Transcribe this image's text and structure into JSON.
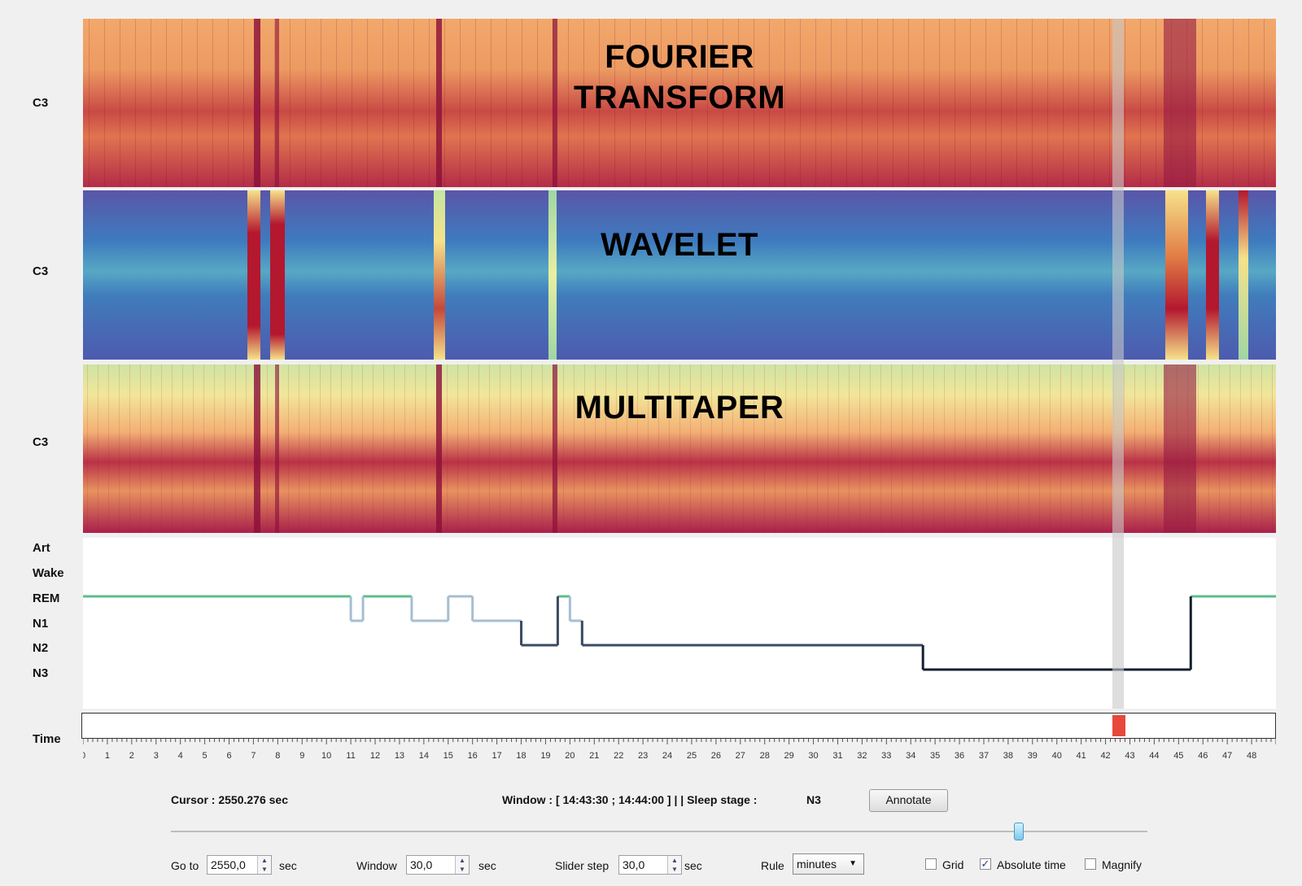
{
  "channels": {
    "fourier": {
      "label": "C3",
      "title_line1": "FOURIER",
      "title_line2": "TRANSFORM"
    },
    "wavelet": {
      "label": "C3",
      "title": "WAVELET"
    },
    "multitaper": {
      "label": "C3",
      "title": "MULTITAPER"
    }
  },
  "hypnogram": {
    "stage_labels": [
      "Art",
      "Wake",
      "REM",
      "N1",
      "N2",
      "N3"
    ],
    "x_max_minutes": 49,
    "segments": [
      {
        "start": 0,
        "end": 11.0,
        "stage": "REM",
        "color": "#5dbd8a"
      },
      {
        "start": 11.0,
        "end": 11.5,
        "stage": "N1",
        "color": "#a6bed2"
      },
      {
        "start": 11.5,
        "end": 13.5,
        "stage": "REM",
        "color": "#5dbd8a"
      },
      {
        "start": 13.5,
        "end": 15.0,
        "stage": "N1",
        "color": "#a6bed2"
      },
      {
        "start": 15.0,
        "end": 16.0,
        "stage": "REM",
        "color": "#a6bed2"
      },
      {
        "start": 16.0,
        "end": 18.0,
        "stage": "N1",
        "color": "#a6bed2"
      },
      {
        "start": 18.0,
        "end": 19.5,
        "stage": "N2",
        "color": "#3b4a60"
      },
      {
        "start": 19.5,
        "end": 20.0,
        "stage": "REM",
        "color": "#5dbd8a"
      },
      {
        "start": 20.0,
        "end": 20.5,
        "stage": "N1",
        "color": "#a6bed2"
      },
      {
        "start": 20.5,
        "end": 34.5,
        "stage": "N2",
        "color": "#3b4a60"
      },
      {
        "start": 34.5,
        "end": 45.5,
        "stage": "N3",
        "color": "#142030"
      },
      {
        "start": 45.5,
        "end": 49,
        "stage": "REM",
        "color": "#5dbd8a"
      }
    ]
  },
  "time_axis": {
    "label": "Time",
    "ticks": [
      "0",
      "1",
      "2",
      "3",
      "4",
      "5",
      "6",
      "7",
      "8",
      "9",
      "10",
      "11",
      "12",
      "13",
      "14",
      "15",
      "16",
      "17",
      "18",
      "19",
      "20",
      "21",
      "22",
      "23",
      "24",
      "25",
      "26",
      "27",
      "28",
      "29",
      "30",
      "31",
      "32",
      "33",
      "34",
      "35",
      "36",
      "37",
      "38",
      "39",
      "40",
      "41",
      "42",
      "43",
      "44",
      "45",
      "46",
      "47",
      "48"
    ],
    "cursor_minutes": 42.5
  },
  "status": {
    "cursor": "Cursor : 2550.276 sec",
    "window": "Window : [ 14:43:30 ; 14:44:00 ] | | Sleep stage :",
    "sleep_stage": "N3",
    "annotate_label": "Annotate"
  },
  "slider": {
    "position_fraction": 0.868
  },
  "controls": {
    "goto_label": "Go to",
    "goto_value": "2550,0",
    "goto_unit": "sec",
    "window_label": "Window",
    "window_value": "30,0",
    "window_unit": "sec",
    "step_label": "Slider step",
    "step_value": "30,0",
    "step_unit": "sec",
    "rule_label": "Rule",
    "rule_value": "minutes",
    "grid_label": "Grid",
    "grid_checked": false,
    "abs_label": "Absolute time",
    "abs_checked": true,
    "magnify_label": "Magnify",
    "magnify_checked": false
  },
  "colors": {
    "accent_marker": "#e8473b",
    "rem": "#5dbd8a",
    "light": "#a6bed2",
    "dark": "#142030"
  }
}
